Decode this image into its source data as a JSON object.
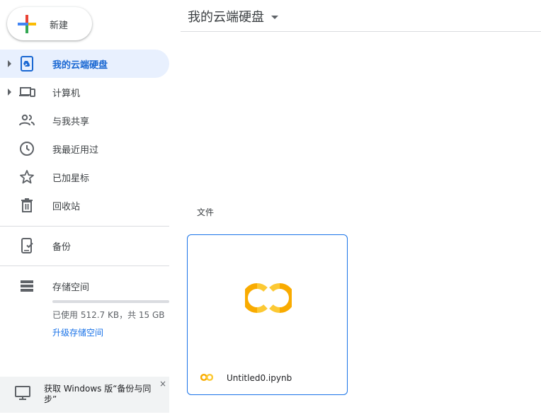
{
  "new_button": {
    "label": "新建",
    "icon": "plus-icon"
  },
  "sidebar": {
    "items": [
      {
        "label": "我的云端硬盘",
        "icon": "drive-icon",
        "active": true,
        "expandable": true
      },
      {
        "label": "计算机",
        "icon": "computers-icon",
        "expandable": true
      },
      {
        "label": "与我共享",
        "icon": "shared-icon"
      },
      {
        "label": "我最近用过",
        "icon": "clock-icon"
      },
      {
        "label": "已加星标",
        "icon": "star-icon"
      },
      {
        "label": "回收站",
        "icon": "trash-icon"
      },
      {
        "label": "备份",
        "icon": "backup-icon"
      },
      {
        "label": "存储空间",
        "icon": "storage-icon"
      }
    ],
    "storage": {
      "used_text": "已使用 512.7 KB，共 15 GB",
      "used_fraction": 0.0,
      "upgrade_label": "升级存储空间"
    },
    "promo": {
      "text": "获取 Windows 版“备份与同步”",
      "close": "×",
      "icon": "monitor-icon"
    }
  },
  "header": {
    "title": "我的云端硬盘"
  },
  "main": {
    "section_label": "文件",
    "files": [
      {
        "name": "Untitled0.ipynb",
        "icon": "colab-icon"
      }
    ]
  },
  "colors": {
    "accent": "#1a73e8",
    "active_bg": "#e8f0fe",
    "colab_orange": "#f9ab00",
    "colab_yellow": "#fcc934"
  }
}
